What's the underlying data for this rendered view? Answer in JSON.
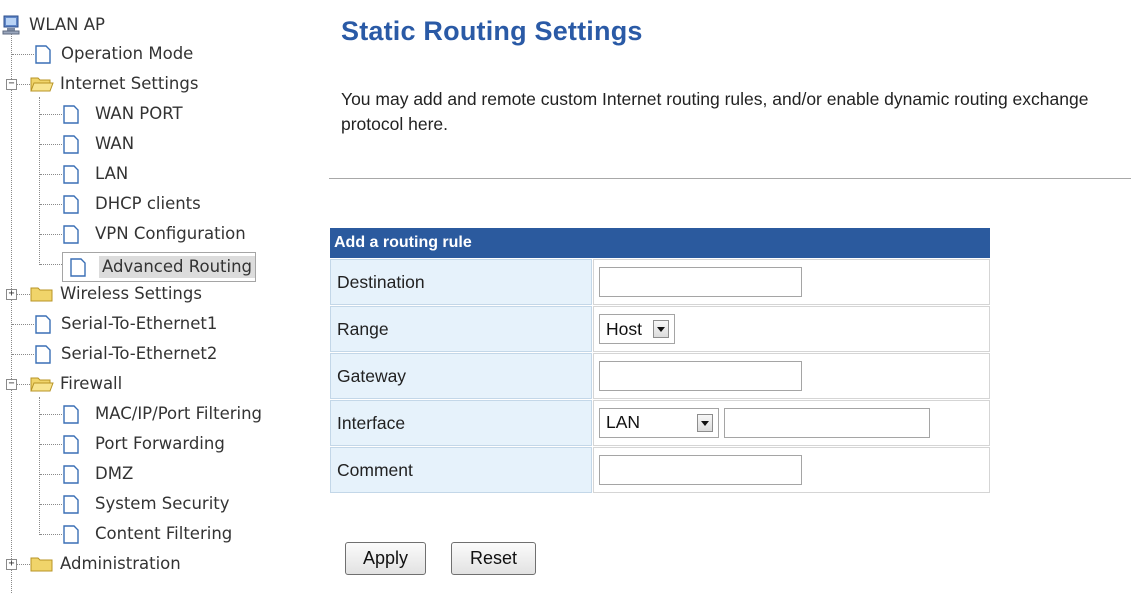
{
  "tree": {
    "root": "WLAN AP",
    "items": [
      {
        "label": "Operation Mode"
      },
      {
        "label": "Internet Settings",
        "expanded": true
      },
      {
        "label": "WAN PORT"
      },
      {
        "label": "WAN"
      },
      {
        "label": "LAN"
      },
      {
        "label": "DHCP clients"
      },
      {
        "label": "VPN Configuration"
      },
      {
        "label": "Advanced Routing",
        "selected": true
      },
      {
        "label": "Wireless Settings",
        "expanded": false
      },
      {
        "label": "Serial-To-Ethernet1"
      },
      {
        "label": "Serial-To-Ethernet2"
      },
      {
        "label": "Firewall",
        "expanded": true
      },
      {
        "label": "MAC/IP/Port Filtering"
      },
      {
        "label": "Port Forwarding"
      },
      {
        "label": "DMZ"
      },
      {
        "label": "System Security"
      },
      {
        "label": "Content Filtering"
      },
      {
        "label": "Administration",
        "expanded": false
      }
    ]
  },
  "page": {
    "title": "Static Routing Settings",
    "intro": "You may add and remote custom Internet routing rules, and/or enable dynamic routing exchange protocol here."
  },
  "form": {
    "header": "Add a routing rule",
    "destination_label": "Destination",
    "destination_value": "",
    "range_label": "Range",
    "range_value": "Host",
    "gateway_label": "Gateway",
    "gateway_value": "",
    "interface_label": "Interface",
    "interface_value": "LAN",
    "interface_custom_value": "",
    "comment_label": "Comment",
    "comment_value": ""
  },
  "buttons": {
    "apply": "Apply",
    "reset": "Reset"
  },
  "colors": {
    "title": "#2a5aa6",
    "table_header": "#2b5a9e",
    "label_cell": "#e6f2fb",
    "selected_item": "#dcdcdc"
  }
}
